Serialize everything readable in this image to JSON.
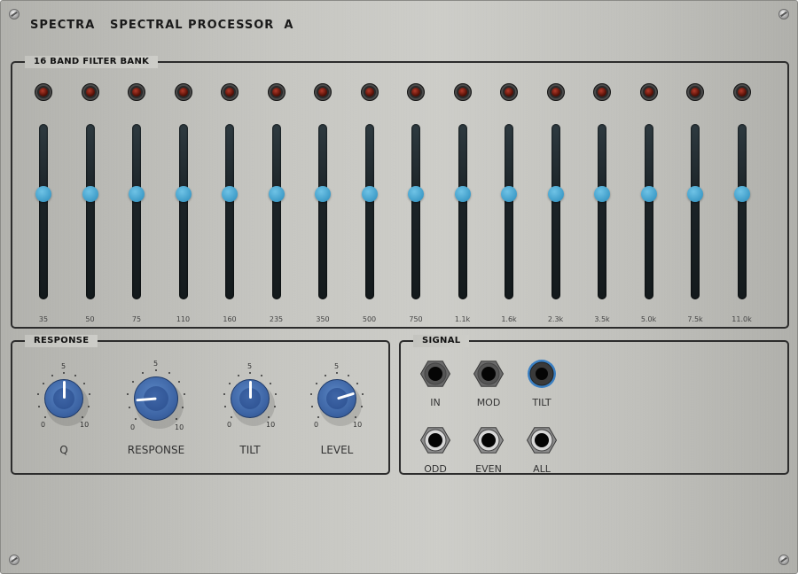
{
  "header": {
    "brand": "SPECTRA",
    "model": "SPECTRAL PROCESSOR  A"
  },
  "filter_bank": {
    "title": "16 BAND FILTER BANK",
    "bands": [
      {
        "freq": "35",
        "level": 0.6
      },
      {
        "freq": "50",
        "level": 0.6
      },
      {
        "freq": "75",
        "level": 0.6
      },
      {
        "freq": "110",
        "level": 0.6
      },
      {
        "freq": "160",
        "level": 0.6
      },
      {
        "freq": "235",
        "level": 0.6
      },
      {
        "freq": "350",
        "level": 0.6
      },
      {
        "freq": "500",
        "level": 0.6
      },
      {
        "freq": "750",
        "level": 0.6
      },
      {
        "freq": "1.1k",
        "level": 0.6
      },
      {
        "freq": "1.6k",
        "level": 0.6
      },
      {
        "freq": "2.3k",
        "level": 0.6
      },
      {
        "freq": "3.5k",
        "level": 0.6
      },
      {
        "freq": "5.0k",
        "level": 0.6
      },
      {
        "freq": "7.5k",
        "level": 0.6
      },
      {
        "freq": "11.0k",
        "level": 0.6
      }
    ]
  },
  "response": {
    "title": "RESPONSE",
    "knobs": [
      {
        "name": "q",
        "label": "Q",
        "min": "0",
        "mid": "5",
        "max": "10",
        "value": 5
      },
      {
        "name": "response",
        "label": "RESPONSE",
        "min": "0",
        "mid": "5",
        "max": "10",
        "value": 1.5
      },
      {
        "name": "tilt",
        "label": "TILT",
        "min": "0",
        "mid": "5",
        "max": "10",
        "value": 5
      },
      {
        "name": "level",
        "label": "LEVEL",
        "min": "0",
        "mid": "5",
        "max": "10",
        "value": 7.7
      }
    ]
  },
  "signal": {
    "title": "SIGNAL",
    "jacks": [
      {
        "name": "in",
        "label": "IN",
        "style": "input"
      },
      {
        "name": "mod",
        "label": "MOD",
        "style": "input"
      },
      {
        "name": "tilt",
        "label": "TILT",
        "style": "cv"
      },
      {
        "name": "odd",
        "label": "ODD",
        "style": "output"
      },
      {
        "name": "even",
        "label": "EVEN",
        "style": "output"
      },
      {
        "name": "all",
        "label": "ALL",
        "style": "output"
      }
    ]
  },
  "colors": {
    "slider_handle": "#3e9cc8",
    "knob": "#3c63a3",
    "cv_ring": "#3a7fc2"
  }
}
